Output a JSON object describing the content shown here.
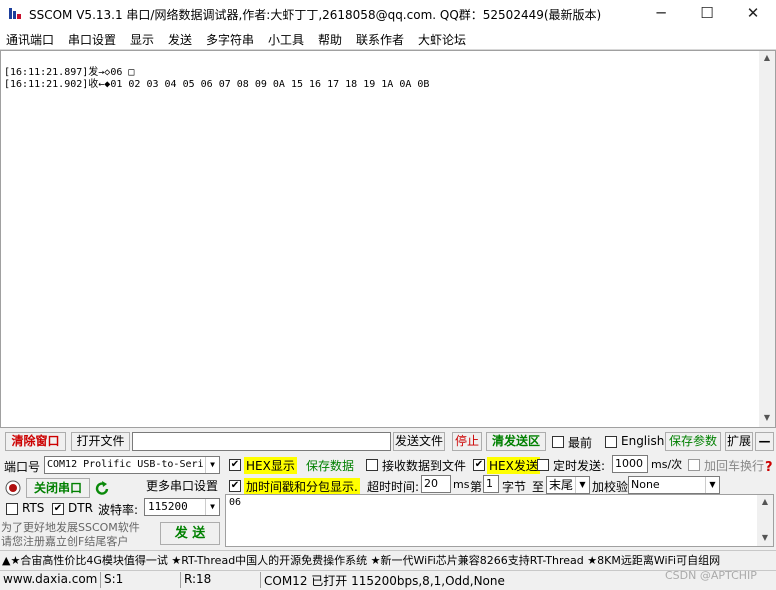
{
  "window": {
    "title": "SSCOM V5.13.1 串口/网络数据调试器,作者:大虾丁丁,2618058@qq.com. QQ群：52502449(最新版本)",
    "minimize": "─",
    "maximize": "☐",
    "close": "✕"
  },
  "menu": [
    "通讯端口",
    "串口设置",
    "显示",
    "发送",
    "多字符串",
    "小工具",
    "帮助",
    "联系作者",
    "大虾论坛"
  ],
  "receive": {
    "lines": [
      "[16:11:21.897]发→◇06 □",
      "[16:11:21.902]收←◆01 02 03 04 05 06 07 08 09 0A 15 16 17 18 19 1A 0A 0B"
    ]
  },
  "file_bar": {
    "clear_window": "清除窗口",
    "open_file": "打开文件",
    "file_path": "",
    "send_file": "发送文件",
    "stop": "停止",
    "clear_send": "清发送区",
    "topmost": "最前",
    "english": "English",
    "save_params": "保存参数",
    "expand": "扩展",
    "collapse": "—"
  },
  "port": {
    "label": "端口号",
    "value": "COM12 Prolific USB-to-Seri",
    "close_port": "关闭串口",
    "more_settings": "更多串口设置",
    "rts": "RTS",
    "dtr": "DTR",
    "baud_label": "波特率:",
    "baud_value": "115200",
    "promo1": "为了更好地发展SSCOM软件",
    "promo2": "请您注册嘉立创F结尾客户",
    "send": "发  送"
  },
  "options": {
    "hex_display": "HEX显示",
    "save_data": "保存数据",
    "recv_to_file": "接收数据到文件",
    "hex_send": "HEX发送",
    "timed_send": "定时发送:",
    "interval": "1000",
    "interval_unit": "ms/次",
    "add_crlf": "加回车换行",
    "timestamp": "加时间戳和分包显示.",
    "timeout_label": "超时时间:",
    "timeout_value": "20",
    "timeout_unit": "ms",
    "byte_prefix": "第",
    "byte_value": "1",
    "byte_suffix": "字节",
    "to_label": "至",
    "to_value": "末尾",
    "checksum_label": "加校验",
    "checksum_value": "None",
    "help": "?"
  },
  "send_area": {
    "content": "06"
  },
  "ticker": "▲★合宙高性价比4G模块值得一试 ★RT-Thread中国人的开源免费操作系统 ★新一代WiFi芯片兼容8266支持RT-Thread ★8KM远距离WiFi可自组网",
  "status": {
    "website": "www.daxia.com",
    "sent": "S:1",
    "received": "R:18",
    "port_info": "COM12 已打开  115200bps,8,1,Odd,None",
    "watermark": "CSDN @APTCHIP"
  },
  "colors": {
    "highlight": "#ffff00",
    "green_text": "#008000",
    "red_text": "#cc0000",
    "refresh_green": "#0a8a0a"
  }
}
